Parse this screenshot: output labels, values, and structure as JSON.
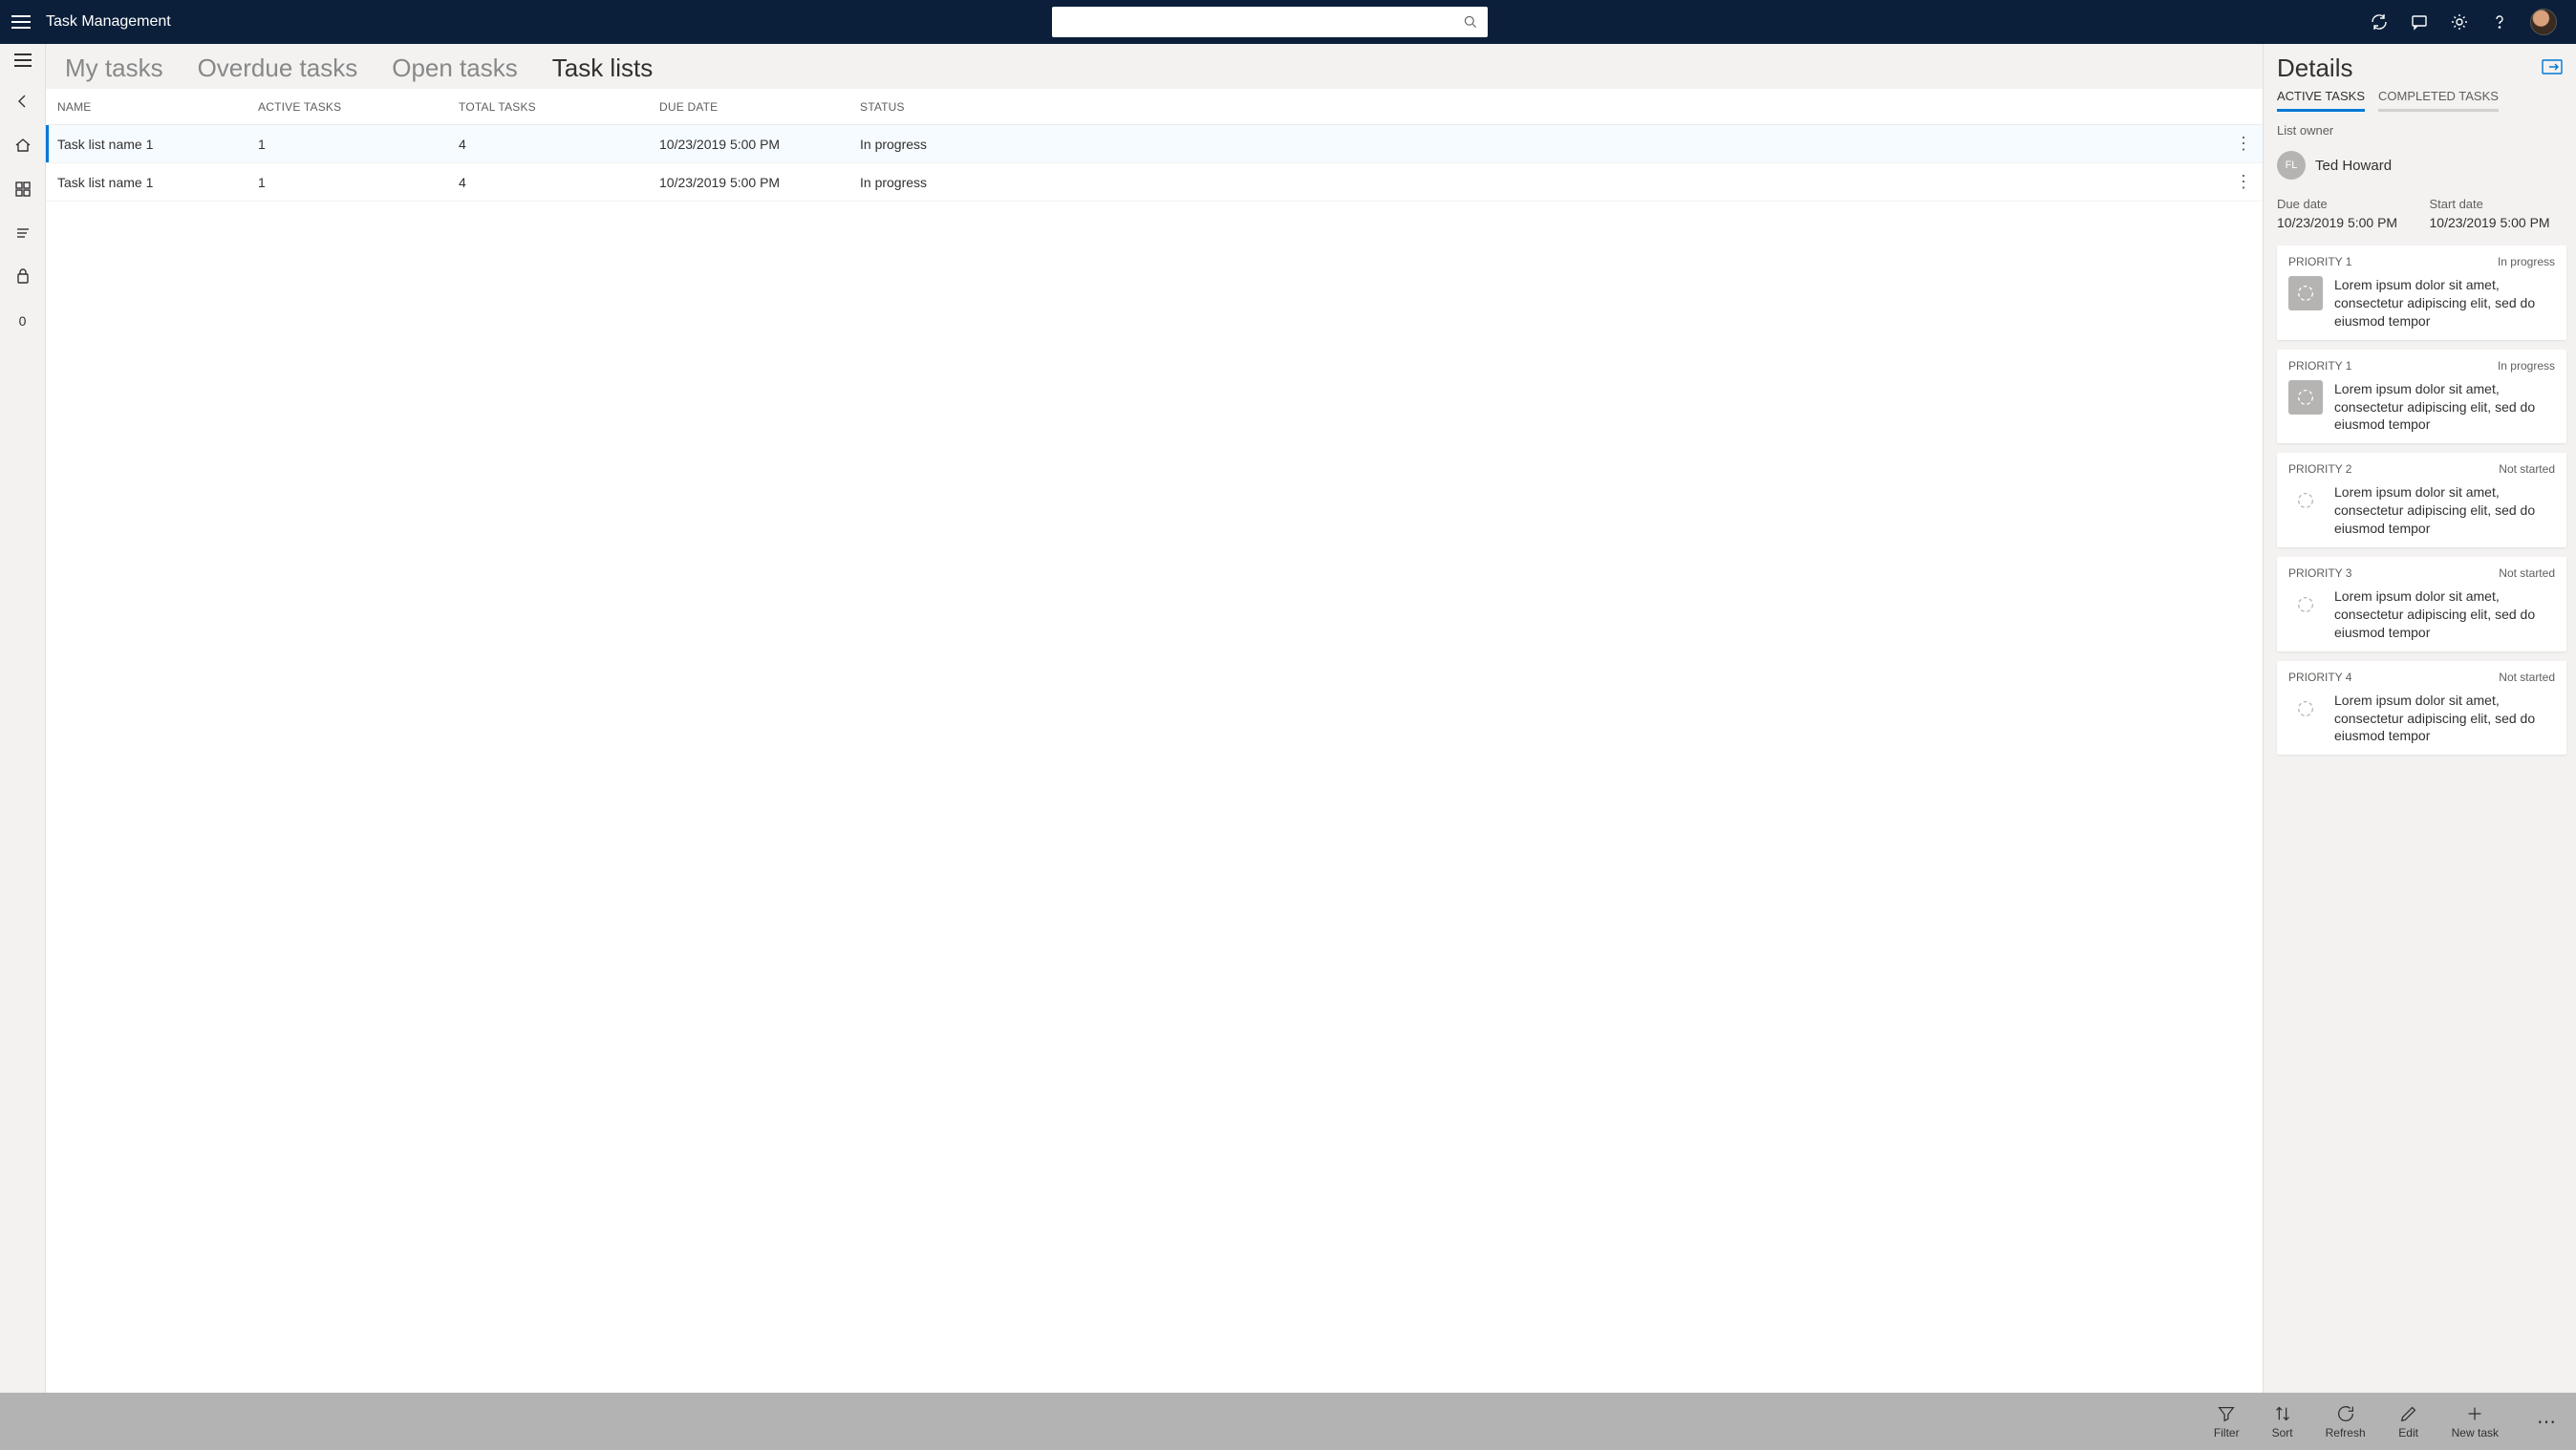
{
  "app_title": "Task Management",
  "search": {
    "placeholder": ""
  },
  "tabs": {
    "my_tasks": "My tasks",
    "overdue": "Overdue tasks",
    "open": "Open tasks",
    "task_lists": "Task lists"
  },
  "table": {
    "headers": {
      "name": "NAME",
      "active": "ACTIVE TASKS",
      "total": "TOTAL TASKS",
      "due": "DUE DATE",
      "status": "STATUS"
    },
    "rows": [
      {
        "name": "Task list name 1",
        "active": "1",
        "total": "4",
        "due": "10/23/2019 5:00 PM",
        "status": "In progress"
      },
      {
        "name": "Task list name 1",
        "active": "1",
        "total": "4",
        "due": "10/23/2019 5:00 PM",
        "status": "In progress"
      }
    ]
  },
  "details": {
    "title": "Details",
    "tabs": {
      "active": "ACTIVE TASKS",
      "completed": "COMPLETED TASKS"
    },
    "owner_label": "List owner",
    "owner_initials": "FL",
    "owner_name": "Ted Howard",
    "due_label": "Due date",
    "due_value": "10/23/2019 5:00 PM",
    "start_label": "Start date",
    "start_value": "10/23/2019 5:00 PM",
    "cards": [
      {
        "priority": "PRIORITY 1",
        "status": "In progress",
        "desc": "Lorem ipsum dolor sit amet, consectetur adipiscing elit, sed do eiusmod tempor",
        "state": "inprog"
      },
      {
        "priority": "PRIORITY 1",
        "status": "In progress",
        "desc": "Lorem ipsum dolor sit amet, consectetur adipiscing elit, sed do eiusmod tempor",
        "state": "inprog"
      },
      {
        "priority": "PRIORITY 2",
        "status": "Not started",
        "desc": "Lorem ipsum dolor sit amet, consectetur adipiscing elit, sed do eiusmod tempor",
        "state": "notstarted"
      },
      {
        "priority": "PRIORITY 3",
        "status": "Not started",
        "desc": "Lorem ipsum dolor sit amet, consectetur adipiscing elit, sed do eiusmod tempor",
        "state": "notstarted"
      },
      {
        "priority": "PRIORITY 4",
        "status": "Not started",
        "desc": "Lorem ipsum dolor sit amet, consectetur adipiscing elit, sed do eiusmod tempor",
        "state": "notstarted"
      }
    ]
  },
  "commandbar": {
    "filter": "Filter",
    "sort": "Sort",
    "refresh": "Refresh",
    "edit": "Edit",
    "new_task": "New task"
  },
  "rail_zero": "0"
}
